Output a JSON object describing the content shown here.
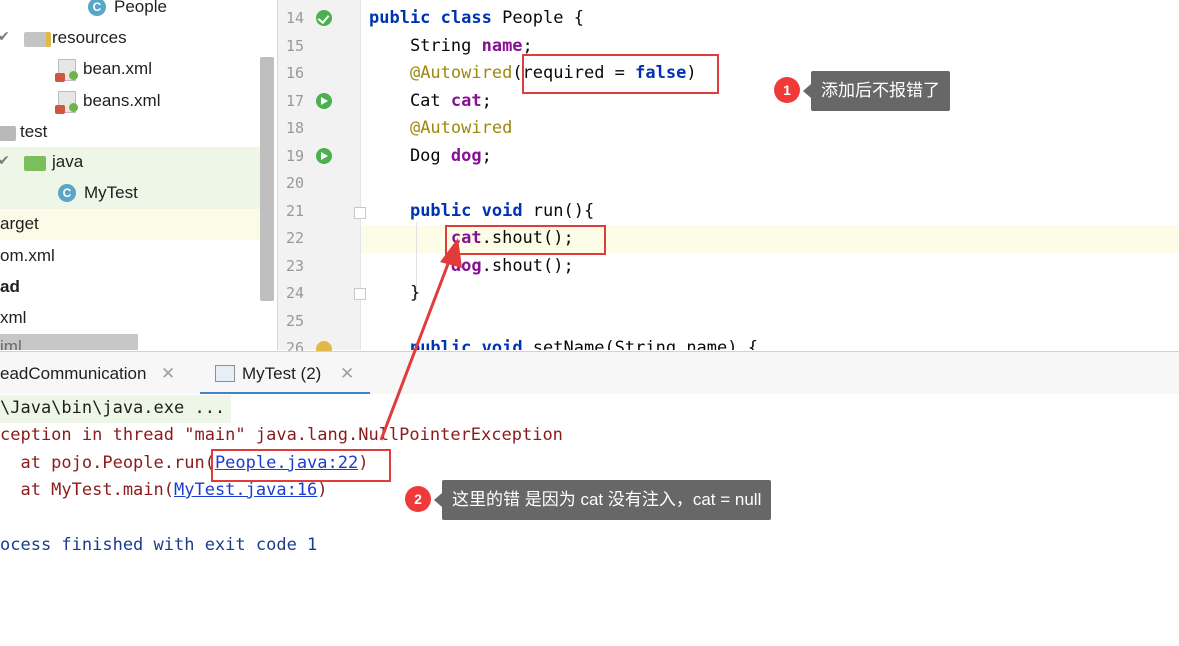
{
  "project_tree": {
    "items": [
      {
        "label": "People",
        "icon": "java-class-icon"
      },
      {
        "label": "resources",
        "icon": "resources-folder-icon"
      },
      {
        "label": "bean.xml",
        "icon": "xml-file-icon"
      },
      {
        "label": "beans.xml",
        "icon": "xml-file-icon"
      },
      {
        "label": "test",
        "icon": "folder-icon"
      },
      {
        "label": "java",
        "icon": "test-source-folder-icon"
      },
      {
        "label": "MyTest",
        "icon": "java-test-class-icon"
      },
      {
        "label": "arget",
        "icon": ""
      },
      {
        "label": "om.xml",
        "icon": ""
      },
      {
        "label": "ad",
        "icon": ""
      },
      {
        "label": "xml",
        "icon": ""
      },
      {
        "label": "iml",
        "icon": ""
      }
    ]
  },
  "editor": {
    "line_numbers": [
      "14",
      "15",
      "16",
      "17",
      "18",
      "19",
      "20",
      "21",
      "22",
      "23",
      "24",
      "25",
      "26"
    ],
    "lines": [
      [
        {
          "t": "public ",
          "c": "kw"
        },
        {
          "t": "class ",
          "c": "kw"
        },
        {
          "t": "People {",
          "c": ""
        }
      ],
      [
        {
          "t": "    String ",
          "c": ""
        },
        {
          "t": "name",
          "c": "fld"
        },
        {
          "t": ";",
          "c": ""
        }
      ],
      [
        {
          "t": "    ",
          "c": ""
        },
        {
          "t": "@Autowired",
          "c": "ann"
        },
        {
          "t": "(required = ",
          "c": ""
        },
        {
          "t": "false",
          "c": "kw"
        },
        {
          "t": ")",
          "c": ""
        }
      ],
      [
        {
          "t": "    Cat ",
          "c": ""
        },
        {
          "t": "cat",
          "c": "fld"
        },
        {
          "t": ";",
          "c": ""
        }
      ],
      [
        {
          "t": "    ",
          "c": ""
        },
        {
          "t": "@Autowired",
          "c": "ann"
        }
      ],
      [
        {
          "t": "    Dog ",
          "c": ""
        },
        {
          "t": "dog",
          "c": "fld"
        },
        {
          "t": ";",
          "c": ""
        }
      ],
      [
        {
          "t": "",
          "c": ""
        }
      ],
      [
        {
          "t": "    ",
          "c": ""
        },
        {
          "t": "public ",
          "c": "kw"
        },
        {
          "t": "void ",
          "c": "kw"
        },
        {
          "t": "run(){",
          "c": ""
        }
      ],
      [
        {
          "t": "        ",
          "c": ""
        },
        {
          "t": "cat",
          "c": "fld"
        },
        {
          "t": ".shout();",
          "c": ""
        }
      ],
      [
        {
          "t": "        ",
          "c": ""
        },
        {
          "t": "dog",
          "c": "fld"
        },
        {
          "t": ".shout();",
          "c": ""
        }
      ],
      [
        {
          "t": "    }",
          "c": ""
        }
      ],
      [
        {
          "t": "",
          "c": ""
        }
      ],
      [
        {
          "t": "    ",
          "c": ""
        },
        {
          "t": "public ",
          "c": "kw"
        },
        {
          "t": "void ",
          "c": "kw"
        },
        {
          "t": "setName(String name) {",
          "c": ""
        }
      ]
    ]
  },
  "run_panel": {
    "tabs": [
      {
        "label": "eadCommunication",
        "active": false
      },
      {
        "label": "MyTest (2)",
        "active": true
      }
    ],
    "console": {
      "command": "\\Java\\bin\\java.exe ...",
      "exception": "ception in thread \"main\" java.lang.NullPointerException",
      "trace1_prefix": "  at pojo.People.run(",
      "trace1_link": "People.java:22",
      "trace1_suffix": ")",
      "trace2_prefix": "  at MyTest.main(",
      "trace2_link": "MyTest.java:16",
      "trace2_suffix": ")",
      "finish": "ocess finished with exit code 1"
    }
  },
  "annotations": {
    "note1": {
      "number": "1",
      "text": "添加后不报错了"
    },
    "note2": {
      "number": "2",
      "text": "这里的错 是因为 cat 没有注入，cat = null"
    },
    "accent_color": "#e23b3b"
  }
}
